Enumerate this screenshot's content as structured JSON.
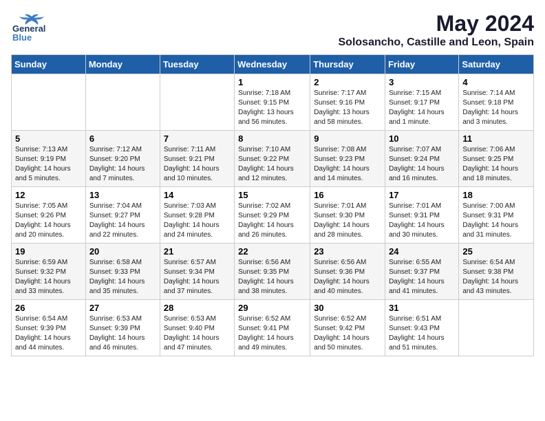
{
  "header": {
    "logo_general": "General",
    "logo_blue": "Blue",
    "title": "May 2024",
    "subtitle": "Solosancho, Castille and Leon, Spain"
  },
  "weekdays": [
    "Sunday",
    "Monday",
    "Tuesday",
    "Wednesday",
    "Thursday",
    "Friday",
    "Saturday"
  ],
  "weeks": [
    [
      {
        "day": "",
        "sunrise": "",
        "sunset": "",
        "daylight": ""
      },
      {
        "day": "",
        "sunrise": "",
        "sunset": "",
        "daylight": ""
      },
      {
        "day": "",
        "sunrise": "",
        "sunset": "",
        "daylight": ""
      },
      {
        "day": "1",
        "sunrise": "Sunrise: 7:18 AM",
        "sunset": "Sunset: 9:15 PM",
        "daylight": "Daylight: 13 hours and 56 minutes."
      },
      {
        "day": "2",
        "sunrise": "Sunrise: 7:17 AM",
        "sunset": "Sunset: 9:16 PM",
        "daylight": "Daylight: 13 hours and 58 minutes."
      },
      {
        "day": "3",
        "sunrise": "Sunrise: 7:15 AM",
        "sunset": "Sunset: 9:17 PM",
        "daylight": "Daylight: 14 hours and 1 minute."
      },
      {
        "day": "4",
        "sunrise": "Sunrise: 7:14 AM",
        "sunset": "Sunset: 9:18 PM",
        "daylight": "Daylight: 14 hours and 3 minutes."
      }
    ],
    [
      {
        "day": "5",
        "sunrise": "Sunrise: 7:13 AM",
        "sunset": "Sunset: 9:19 PM",
        "daylight": "Daylight: 14 hours and 5 minutes."
      },
      {
        "day": "6",
        "sunrise": "Sunrise: 7:12 AM",
        "sunset": "Sunset: 9:20 PM",
        "daylight": "Daylight: 14 hours and 7 minutes."
      },
      {
        "day": "7",
        "sunrise": "Sunrise: 7:11 AM",
        "sunset": "Sunset: 9:21 PM",
        "daylight": "Daylight: 14 hours and 10 minutes."
      },
      {
        "day": "8",
        "sunrise": "Sunrise: 7:10 AM",
        "sunset": "Sunset: 9:22 PM",
        "daylight": "Daylight: 14 hours and 12 minutes."
      },
      {
        "day": "9",
        "sunrise": "Sunrise: 7:08 AM",
        "sunset": "Sunset: 9:23 PM",
        "daylight": "Daylight: 14 hours and 14 minutes."
      },
      {
        "day": "10",
        "sunrise": "Sunrise: 7:07 AM",
        "sunset": "Sunset: 9:24 PM",
        "daylight": "Daylight: 14 hours and 16 minutes."
      },
      {
        "day": "11",
        "sunrise": "Sunrise: 7:06 AM",
        "sunset": "Sunset: 9:25 PM",
        "daylight": "Daylight: 14 hours and 18 minutes."
      }
    ],
    [
      {
        "day": "12",
        "sunrise": "Sunrise: 7:05 AM",
        "sunset": "Sunset: 9:26 PM",
        "daylight": "Daylight: 14 hours and 20 minutes."
      },
      {
        "day": "13",
        "sunrise": "Sunrise: 7:04 AM",
        "sunset": "Sunset: 9:27 PM",
        "daylight": "Daylight: 14 hours and 22 minutes."
      },
      {
        "day": "14",
        "sunrise": "Sunrise: 7:03 AM",
        "sunset": "Sunset: 9:28 PM",
        "daylight": "Daylight: 14 hours and 24 minutes."
      },
      {
        "day": "15",
        "sunrise": "Sunrise: 7:02 AM",
        "sunset": "Sunset: 9:29 PM",
        "daylight": "Daylight: 14 hours and 26 minutes."
      },
      {
        "day": "16",
        "sunrise": "Sunrise: 7:01 AM",
        "sunset": "Sunset: 9:30 PM",
        "daylight": "Daylight: 14 hours and 28 minutes."
      },
      {
        "day": "17",
        "sunrise": "Sunrise: 7:01 AM",
        "sunset": "Sunset: 9:31 PM",
        "daylight": "Daylight: 14 hours and 30 minutes."
      },
      {
        "day": "18",
        "sunrise": "Sunrise: 7:00 AM",
        "sunset": "Sunset: 9:31 PM",
        "daylight": "Daylight: 14 hours and 31 minutes."
      }
    ],
    [
      {
        "day": "19",
        "sunrise": "Sunrise: 6:59 AM",
        "sunset": "Sunset: 9:32 PM",
        "daylight": "Daylight: 14 hours and 33 minutes."
      },
      {
        "day": "20",
        "sunrise": "Sunrise: 6:58 AM",
        "sunset": "Sunset: 9:33 PM",
        "daylight": "Daylight: 14 hours and 35 minutes."
      },
      {
        "day": "21",
        "sunrise": "Sunrise: 6:57 AM",
        "sunset": "Sunset: 9:34 PM",
        "daylight": "Daylight: 14 hours and 37 minutes."
      },
      {
        "day": "22",
        "sunrise": "Sunrise: 6:56 AM",
        "sunset": "Sunset: 9:35 PM",
        "daylight": "Daylight: 14 hours and 38 minutes."
      },
      {
        "day": "23",
        "sunrise": "Sunrise: 6:56 AM",
        "sunset": "Sunset: 9:36 PM",
        "daylight": "Daylight: 14 hours and 40 minutes."
      },
      {
        "day": "24",
        "sunrise": "Sunrise: 6:55 AM",
        "sunset": "Sunset: 9:37 PM",
        "daylight": "Daylight: 14 hours and 41 minutes."
      },
      {
        "day": "25",
        "sunrise": "Sunrise: 6:54 AM",
        "sunset": "Sunset: 9:38 PM",
        "daylight": "Daylight: 14 hours and 43 minutes."
      }
    ],
    [
      {
        "day": "26",
        "sunrise": "Sunrise: 6:54 AM",
        "sunset": "Sunset: 9:39 PM",
        "daylight": "Daylight: 14 hours and 44 minutes."
      },
      {
        "day": "27",
        "sunrise": "Sunrise: 6:53 AM",
        "sunset": "Sunset: 9:39 PM",
        "daylight": "Daylight: 14 hours and 46 minutes."
      },
      {
        "day": "28",
        "sunrise": "Sunrise: 6:53 AM",
        "sunset": "Sunset: 9:40 PM",
        "daylight": "Daylight: 14 hours and 47 minutes."
      },
      {
        "day": "29",
        "sunrise": "Sunrise: 6:52 AM",
        "sunset": "Sunset: 9:41 PM",
        "daylight": "Daylight: 14 hours and 49 minutes."
      },
      {
        "day": "30",
        "sunrise": "Sunrise: 6:52 AM",
        "sunset": "Sunset: 9:42 PM",
        "daylight": "Daylight: 14 hours and 50 minutes."
      },
      {
        "day": "31",
        "sunrise": "Sunrise: 6:51 AM",
        "sunset": "Sunset: 9:43 PM",
        "daylight": "Daylight: 14 hours and 51 minutes."
      },
      {
        "day": "",
        "sunrise": "",
        "sunset": "",
        "daylight": ""
      }
    ]
  ]
}
